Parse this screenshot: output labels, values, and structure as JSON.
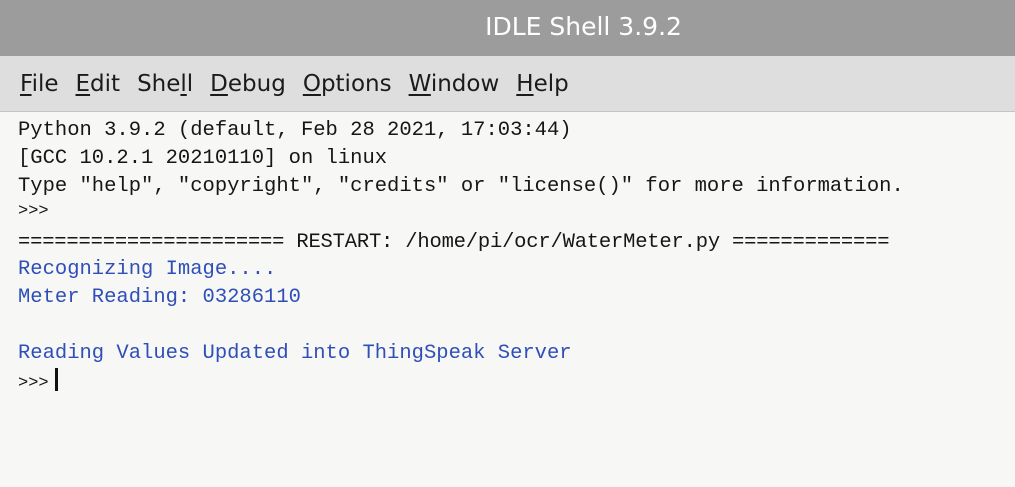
{
  "window": {
    "title": "IDLE Shell 3.9.2"
  },
  "menubar": {
    "items": [
      {
        "mnemonic": "F",
        "rest": "ile"
      },
      {
        "mnemonic": "E",
        "rest": "dit"
      },
      {
        "pre": "She",
        "mnemonic": "l",
        "rest": "l"
      },
      {
        "mnemonic": "D",
        "rest": "ebug"
      },
      {
        "mnemonic": "O",
        "rest": "ptions"
      },
      {
        "mnemonic": "W",
        "rest": "indow"
      },
      {
        "mnemonic": "H",
        "rest": "elp"
      }
    ]
  },
  "shell": {
    "banner": [
      "Python 3.9.2 (default, Feb 28 2021, 17:03:44)",
      "[GCC 10.2.1 20210110] on linux",
      "Type \"help\", \"copyright\", \"credits\" or \"license()\" for more information."
    ],
    "prompt": ">>>",
    "restart_line": "====================== RESTART: /home/pi/ocr/WaterMeter.py =============",
    "output": [
      "Recognizing Image....",
      "Meter Reading: 03286110",
      "",
      "Reading Values Updated into ThingSpeak Server"
    ],
    "final_prompt": ">>>"
  },
  "colors": {
    "titlebar": "#9c9c9c",
    "menubar": "#dedede",
    "shell_background": "#f7f7f5",
    "stdout_text": "#2f4fb8",
    "default_text": "#161616"
  }
}
